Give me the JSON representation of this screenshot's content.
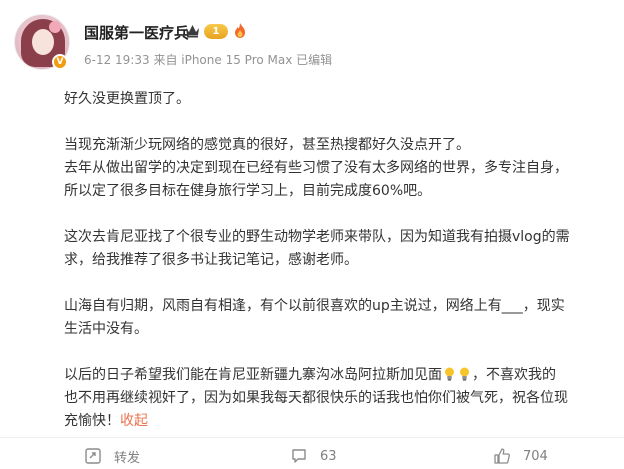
{
  "user": {
    "name": "国服第一医疗兵",
    "level_badge": "1",
    "verified_mark": "V"
  },
  "post": {
    "meta": "6-12 19:33  来自 iPhone 15 Pro Max  已编辑",
    "lines": [
      "好久没更换置顶了。",
      "",
      "当现充渐渐少玩网络的感觉真的很好，甚至热搜都好久没点开了。",
      "去年从做出留学的决定到现在已经有些习惯了没有太多网络的世界，多专注自身，",
      "所以定了很多目标在健身旅行学习上，目前完成度60%吧。",
      "",
      "这次去肯尼亚找了个很专业的野生动物学老师来带队，因为知道我有拍摄vlog的需",
      "求，给我推荐了很多书让我记笔记，感谢老师。",
      "",
      "山海自有归期，风雨自有相逢，有个以前很喜欢的up主说过，网络上有___，现实",
      "生活中没有。",
      ""
    ],
    "last_para_1": "以后的日子希望我们能在肯尼亚新疆九寨沟冰岛阿拉斯加见面",
    "last_para_1_tail": "，不喜欢我的",
    "last_para_2": "也不用再继续视奸了，因为如果我每天都很快乐的话我也怕你们被气死，祝各位现",
    "last_para_3": "充愉快！",
    "collapse_label": "收起"
  },
  "actions": {
    "repost_label": "转发",
    "comment_count": "63",
    "like_count": "704"
  },
  "icons": {
    "repost": "repost-icon",
    "comment": "comment-icon",
    "like": "like-icon",
    "crown": "crown-icon",
    "fire": "fire-icon"
  },
  "colors": {
    "accent": "#eb7350",
    "meta_gray": "#939393",
    "badge_gold": "#f29b11"
  }
}
